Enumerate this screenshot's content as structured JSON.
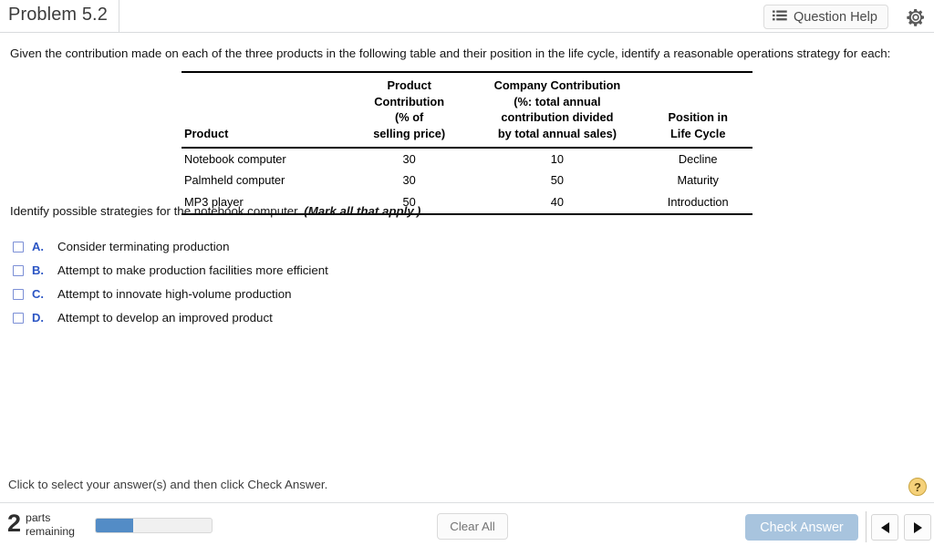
{
  "header": {
    "problem_title": "Problem 5.2",
    "question_help_label": "Question Help",
    "list_icon": "list-icon",
    "gear_icon": "gear-icon"
  },
  "main": {
    "prompt": "Given the contribution made on each of the three products in the following table and their position in the life cycle, identify a reasonable operations strategy for each:",
    "table": {
      "headers": [
        "Product",
        "Product\nContribution\n(% of\nselling price)",
        "Company Contribution\n(%: total annual\ncontribution divided\nby total annual sales)",
        "Position in\nLife Cycle"
      ],
      "header_lines": {
        "product": [
          "Product"
        ],
        "product_contribution": [
          "Product",
          "Contribution",
          "(% of",
          "selling price)"
        ],
        "company_contribution": [
          "Company Contribution",
          "(%: total annual",
          "contribution divided",
          "by total annual sales)"
        ],
        "position": [
          "Position in",
          "Life Cycle"
        ]
      },
      "rows": [
        {
          "product": "Notebook computer",
          "product_contribution": "30",
          "company_contribution": "10",
          "position": "Decline"
        },
        {
          "product": "Palmheld computer",
          "product_contribution": "30",
          "company_contribution": "50",
          "position": "Maturity"
        },
        {
          "product": "MP3 player",
          "product_contribution": "50",
          "company_contribution": "40",
          "position": "Introduction"
        }
      ]
    },
    "instruction_text": "Identify possible strategies for the notebook computer.",
    "instruction_emphasis": "(Mark all that apply.)",
    "choices": [
      {
        "letter": "A.",
        "text": "Consider terminating production",
        "checked": false
      },
      {
        "letter": "B.",
        "text": "Attempt to make production facilities more efficient",
        "checked": false
      },
      {
        "letter": "C.",
        "text": "Attempt to innovate high-volume production",
        "checked": false
      },
      {
        "letter": "D.",
        "text": "Attempt to develop an improved product",
        "checked": false
      }
    ]
  },
  "footer": {
    "hint": "Click to select your answer(s) and then click Check Answer.",
    "help_badge": "?",
    "parts_count": "2",
    "parts_label_line1": "parts",
    "parts_label_line2": "remaining",
    "progress_percent": 32,
    "clear_all_label": "Clear All",
    "check_answer_label": "Check Answer",
    "prev_icon": "triangle-left-icon",
    "next_icon": "triangle-right-icon"
  },
  "colors": {
    "accent_blue": "#2b55c4",
    "checkbox_border": "#7b8fd6",
    "progress_fill": "#538cc6",
    "check_button": "#a8c4de",
    "help_badge": "#f5d17a"
  }
}
